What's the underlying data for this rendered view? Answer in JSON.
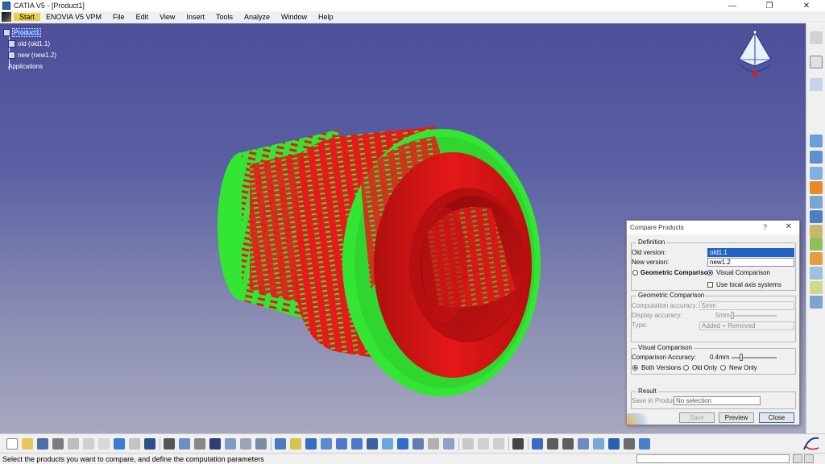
{
  "window": {
    "title": "CATIA V5 - [Product1]"
  },
  "menu": {
    "items": [
      "Start",
      "ENOVIA V5 VPM",
      "File",
      "Edit",
      "View",
      "Insert",
      "Tools",
      "Analyze",
      "Window",
      "Help"
    ]
  },
  "tree": {
    "root": "Product1",
    "children": [
      "old (old1.1)",
      "new (new1.2)"
    ],
    "applications": "Applications"
  },
  "dialog": {
    "title": "Compare Products",
    "help": "?",
    "close": "✕",
    "definition": {
      "legend": "Definition",
      "old_label": "Old version:",
      "old_value": "old1.1",
      "new_label": "New version:",
      "new_value": "new1.2",
      "geo_radio": "Geometric Comparison",
      "visual_radio": "Visual Comparison",
      "local_axis": "Use local axis systems"
    },
    "geometric": {
      "legend": "Geometric Comparison",
      "comp_acc_label": "Computation accuracy:",
      "comp_acc_value": "5mm",
      "disp_acc_label": "Display accuracy:",
      "disp_acc_value": "5mm",
      "type_label": "Type:",
      "type_value": "Added + Removed"
    },
    "visual": {
      "legend": "Visual Comparison",
      "acc_label": "Comparison Accuracy:",
      "acc_value": "0.4mm",
      "both": "Both Versions",
      "old_only": "Old Only",
      "new_only": "New Only"
    },
    "result": {
      "legend": "Result",
      "save_label": "Save in Product",
      "save_value": "No selection"
    },
    "buttons": {
      "save": "Save",
      "preview": "Preview",
      "close": "Close"
    }
  },
  "status": {
    "message": "Select the products you want to compare, and define the computation parameters"
  },
  "colors": {
    "old_part": "#e61a1a",
    "new_part": "#33e633",
    "viewport_top": "#4d4f99",
    "viewport_bottom": "#a7a8bf",
    "selection": "#1f63c7"
  }
}
